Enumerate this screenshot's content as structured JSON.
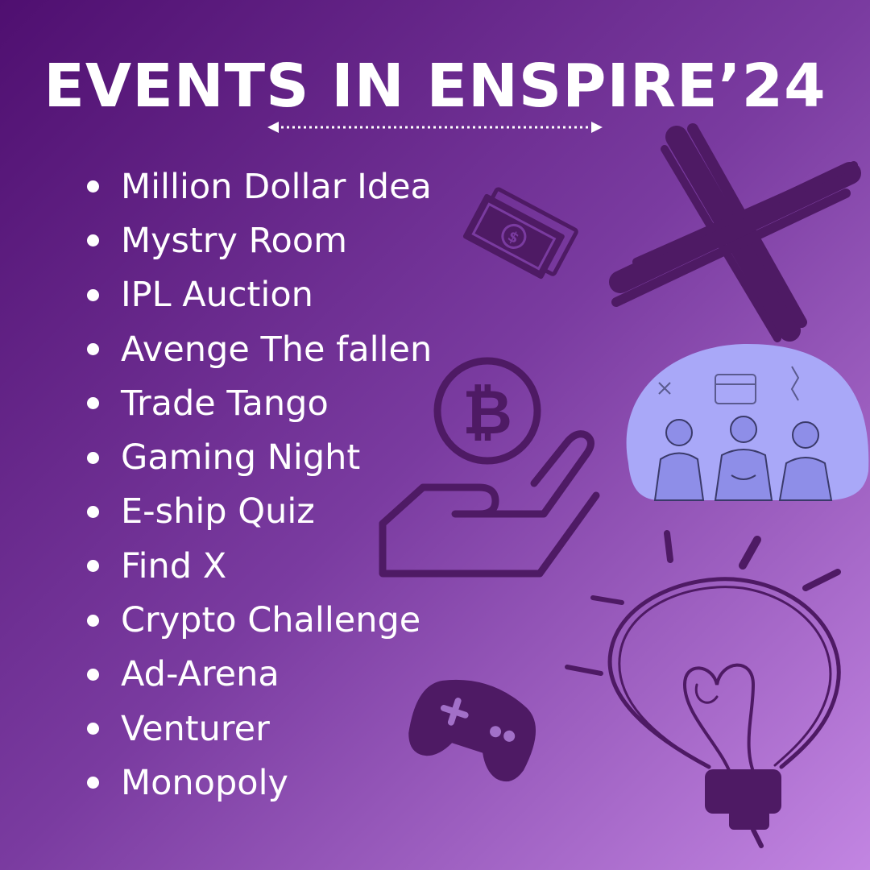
{
  "title": "EVENTS IN ENSPIRE’24",
  "events": [
    "Million Dollar Idea",
    "Mystry Room",
    "IPL Auction",
    "Avenge The fallen",
    "Trade Tango",
    "Gaming Night",
    "E-ship Quiz",
    "Find X",
    "Crypto Challenge",
    "Ad-Arena",
    "Venturer",
    "Monopoly"
  ],
  "icons": [
    "double-arrow-icon",
    "money-icon",
    "cross-x-icon",
    "bitcoin-hand-icon",
    "treasure-hunt-illustration",
    "gamepad-icon",
    "lightbulb-icon"
  ],
  "colors": {
    "background_start": "#4f0f70",
    "background_end": "#c285e2",
    "text": "#ffffff",
    "icon": "#4e1a64",
    "illustration_bg": "#a9a8f8"
  }
}
